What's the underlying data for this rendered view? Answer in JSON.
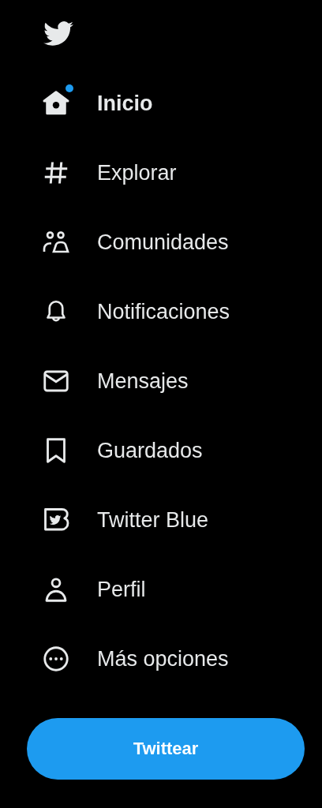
{
  "nav": {
    "items": [
      {
        "kind": "home",
        "label": "Inicio",
        "selected": true,
        "dot": true
      },
      {
        "kind": "explore",
        "label": "Explorar",
        "selected": false,
        "dot": false
      },
      {
        "kind": "communities",
        "label": "Comunidades",
        "selected": false,
        "dot": false
      },
      {
        "kind": "notifications",
        "label": "Notificaciones",
        "selected": false,
        "dot": false
      },
      {
        "kind": "messages",
        "label": "Mensajes",
        "selected": false,
        "dot": false
      },
      {
        "kind": "bookmarks",
        "label": "Guardados",
        "selected": false,
        "dot": false
      },
      {
        "kind": "blue",
        "label": "Twitter Blue",
        "selected": false,
        "dot": false
      },
      {
        "kind": "profile",
        "label": "Perfil",
        "selected": false,
        "dot": false
      },
      {
        "kind": "more",
        "label": "Más opciones",
        "selected": false,
        "dot": false
      }
    ]
  },
  "tweet_button": {
    "label": "Twittear"
  }
}
